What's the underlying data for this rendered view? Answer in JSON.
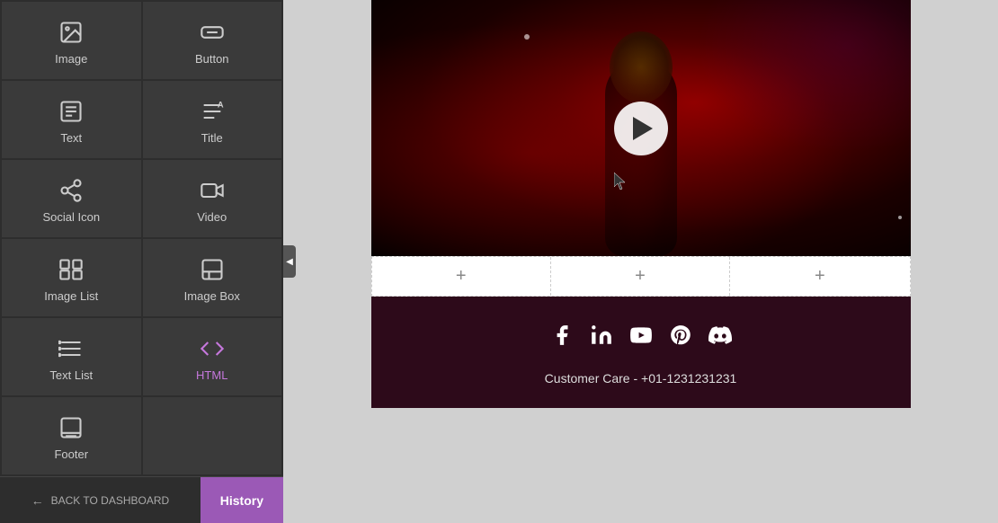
{
  "sidebar": {
    "items": [
      {
        "id": "image",
        "label": "Image",
        "icon": "image"
      },
      {
        "id": "button",
        "label": "Button",
        "icon": "button"
      },
      {
        "id": "text",
        "label": "Text",
        "icon": "text"
      },
      {
        "id": "title",
        "label": "Title",
        "icon": "title"
      },
      {
        "id": "social-icon",
        "label": "Social Icon",
        "icon": "social"
      },
      {
        "id": "video",
        "label": "Video",
        "icon": "video"
      },
      {
        "id": "image-list",
        "label": "Image List",
        "icon": "image-list"
      },
      {
        "id": "image-box",
        "label": "Image Box",
        "icon": "image-box"
      },
      {
        "id": "text-list",
        "label": "Text List",
        "icon": "text-list"
      },
      {
        "id": "html",
        "label": "HTML",
        "icon": "html"
      },
      {
        "id": "footer",
        "label": "Footer",
        "icon": "footer"
      }
    ],
    "back_label": "BACK TO DASHBOARD",
    "history_label": "History"
  },
  "main": {
    "add_symbol": "+",
    "customer_care": "Customer Care - +01-1231231231"
  },
  "social_icons": [
    "facebook",
    "linkedin",
    "youtube",
    "pinterest",
    "discord"
  ]
}
